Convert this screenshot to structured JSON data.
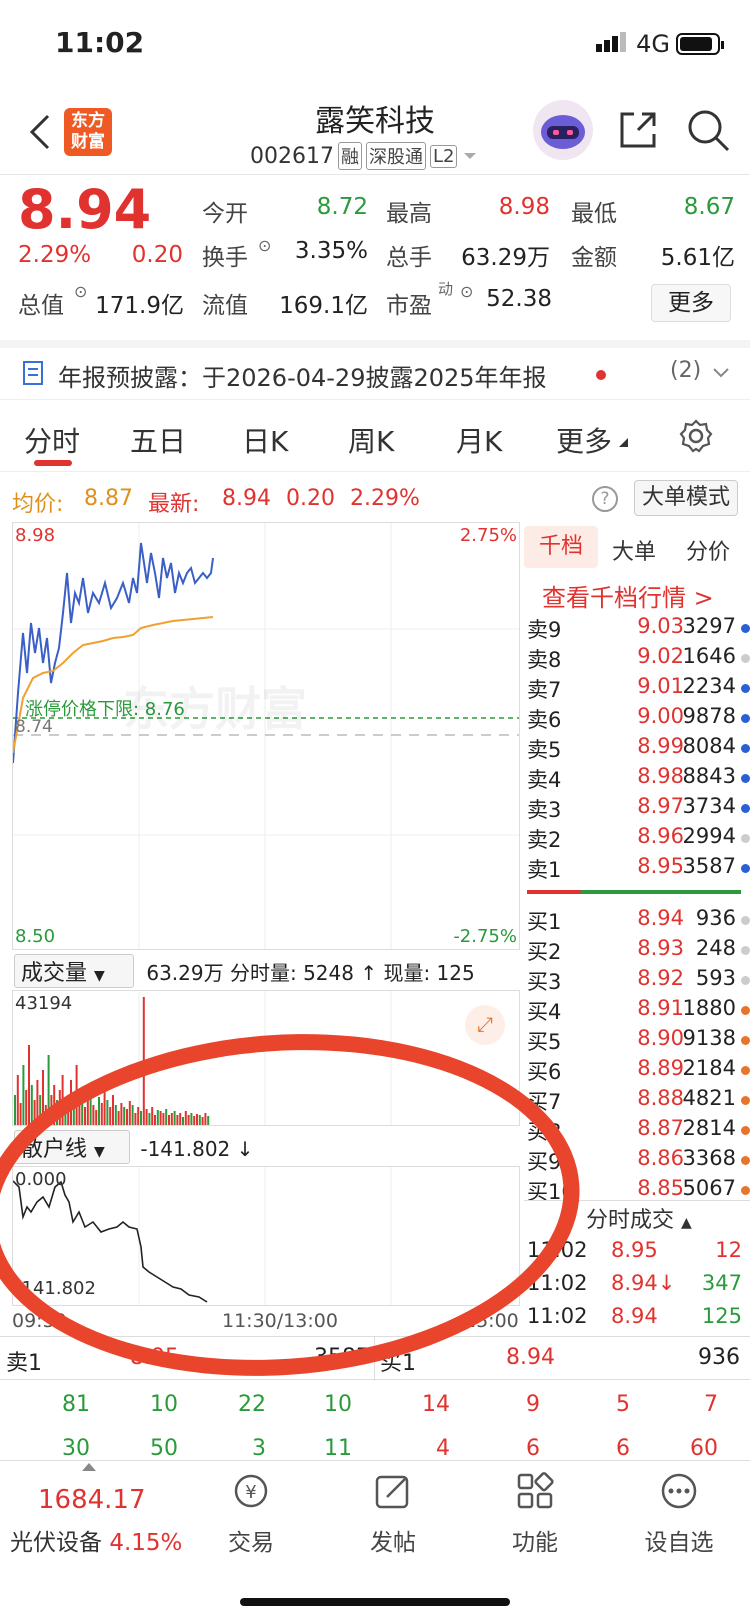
{
  "status_bar": {
    "time": "11:02",
    "network": "4G"
  },
  "header": {
    "logo": [
      "东方",
      "财富"
    ],
    "title": "露笑科技",
    "code": "002617",
    "tags": [
      "融",
      "深股通",
      "L2"
    ]
  },
  "quote": {
    "price": "8.94",
    "pct": "2.29%",
    "chg": "0.20",
    "open_label": "今开",
    "open": "8.72",
    "high_label": "最高",
    "high": "8.98",
    "low_label": "最低",
    "low": "8.67",
    "turnover_label": "换手",
    "turnover": "3.35%",
    "volume_label": "总手",
    "volume": "63.29万",
    "amount_label": "金额",
    "amount": "5.61亿",
    "mcap_label": "总值",
    "mcap": "171.9亿",
    "float_label": "流值",
    "float": "169.1亿",
    "pe_label": "市盈",
    "pe_sup": "动",
    "pe": "52.38",
    "more": "更多"
  },
  "notice": {
    "text": "年报预披露：于2026-04-29披露2025年年报",
    "count": "(2)"
  },
  "tabs": [
    "分时",
    "五日",
    "日K",
    "周K",
    "月K",
    "更多"
  ],
  "avg_line": {
    "avg_label": "均价:",
    "avg": "8.87",
    "latest_label": "最新:",
    "latest": "8.94",
    "chg": "0.20",
    "pct": "2.29%",
    "mode_btn": "大单模式"
  },
  "chart": {
    "top_price": "8.98",
    "top_pct": "2.75%",
    "bottom_price": "8.50",
    "bottom_pct": "-2.75%",
    "limit_label": "涨停价格下限: 8.76",
    "mid_price": "8.74",
    "watermark": "东方财富"
  },
  "volume_panel": {
    "selector": "成交量",
    "summary": "63.29万 分时量: 5248 ↑ 现量: 125",
    "max": "43194"
  },
  "sanhu_panel": {
    "selector": "散户线",
    "value": "-141.802 ↓",
    "top": "0.000",
    "bottom": "-141.802"
  },
  "time_axis": {
    "start": "09:30",
    "mid": "11:30/13:00",
    "end": "15:00"
  },
  "orderbook": {
    "tabs": [
      "千档",
      "大单",
      "分价"
    ],
    "link": "查看千档行情 >",
    "asks": [
      {
        "label": "卖9",
        "price": "9.03",
        "qty": "3297",
        "dot": "#2a5fd6"
      },
      {
        "label": "卖8",
        "price": "9.02",
        "qty": "1646",
        "dot": "#cccccc"
      },
      {
        "label": "卖7",
        "price": "9.01",
        "qty": "2234",
        "dot": "#2a5fd6"
      },
      {
        "label": "卖6",
        "price": "9.00",
        "qty": "9878",
        "dot": "#2a5fd6"
      },
      {
        "label": "卖5",
        "price": "8.99",
        "qty": "8084",
        "dot": "#2a5fd6"
      },
      {
        "label": "卖4",
        "price": "8.98",
        "qty": "8843",
        "dot": "#2a5fd6"
      },
      {
        "label": "卖3",
        "price": "8.97",
        "qty": "3734",
        "dot": "#2a5fd6"
      },
      {
        "label": "卖2",
        "price": "8.96",
        "qty": "2994",
        "dot": "#cccccc"
      },
      {
        "label": "卖1",
        "price": "8.95",
        "qty": "3587",
        "dot": "#2a5fd6"
      }
    ],
    "bids": [
      {
        "label": "买1",
        "price": "8.94",
        "qty": "936",
        "dot": "#cccccc"
      },
      {
        "label": "买2",
        "price": "8.93",
        "qty": "248",
        "dot": "#cccccc"
      },
      {
        "label": "买3",
        "price": "8.92",
        "qty": "593",
        "dot": "#cccccc"
      },
      {
        "label": "买4",
        "price": "8.91",
        "qty": "1880",
        "dot": "#e8742c"
      },
      {
        "label": "买5",
        "price": "8.90",
        "qty": "9138",
        "dot": "#e8742c"
      },
      {
        "label": "买6",
        "price": "8.89",
        "qty": "2184",
        "dot": "#e8742c"
      },
      {
        "label": "买7",
        "price": "8.88",
        "qty": "4821",
        "dot": "#e8742c"
      },
      {
        "label": "买8",
        "price": "8.87",
        "qty": "2814",
        "dot": "#e8742c"
      },
      {
        "label": "买9",
        "price": "8.86",
        "qty": "3368",
        "dot": "#e8742c"
      },
      {
        "label": "买10",
        "price": "8.85",
        "qty": "5067",
        "dot": "#e8742c"
      }
    ],
    "trades_title": "分时成交",
    "trades": [
      {
        "time": "11:02",
        "price": "8.95",
        "qty": "12",
        "qty_color": "#e0332f"
      },
      {
        "time": "11:02",
        "price": "8.94↓",
        "qty": "347",
        "qty_color": "#2a9a3a"
      },
      {
        "time": "11:02",
        "price": "8.94",
        "qty": "125",
        "qty_color": "#2a9a3a"
      }
    ]
  },
  "bottom_quote": {
    "sell_label": "卖1",
    "sell_price": "8.95",
    "sell_qty": "3587",
    "buy_label": "买1",
    "buy_price": "8.94",
    "buy_qty": "936"
  },
  "bottom_nums": {
    "row1": [
      "81",
      "10",
      "22",
      "10",
      "14",
      "9",
      "5",
      "7"
    ],
    "row2": [
      "30",
      "50",
      "3",
      "11",
      "4",
      "6",
      "6",
      "60"
    ]
  },
  "toolbar": {
    "index_value": "1684.17",
    "index_name": "光伏设备",
    "index_pct": "4.15%",
    "items": [
      "交易",
      "发帖",
      "功能",
      "设自选"
    ]
  }
}
